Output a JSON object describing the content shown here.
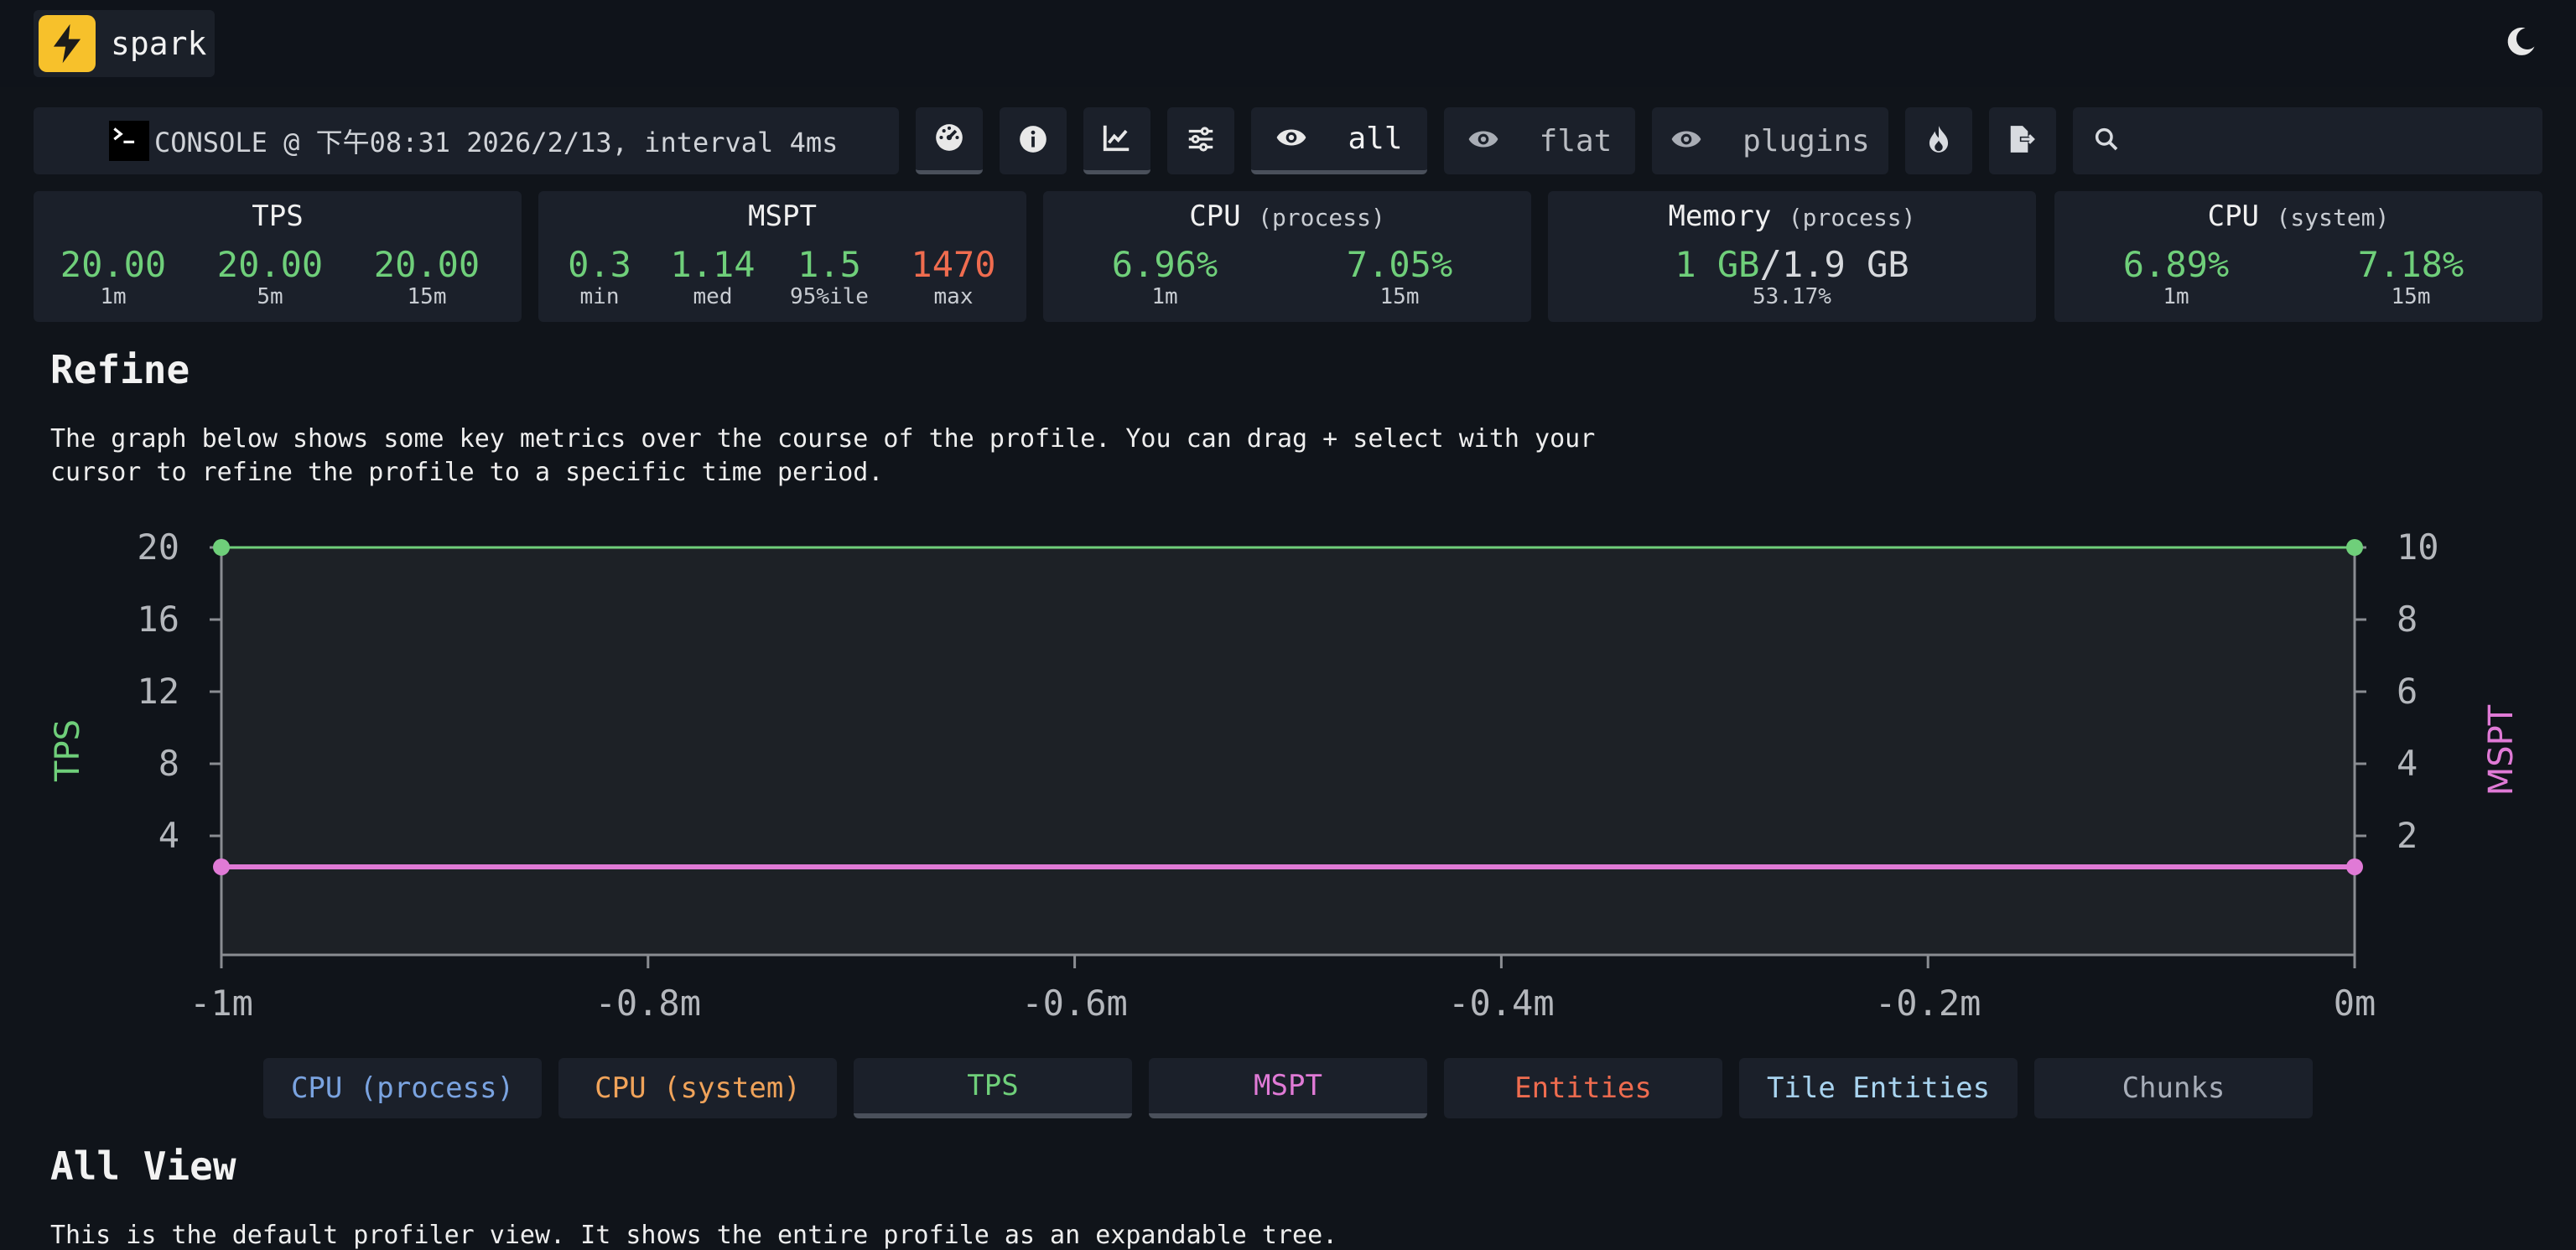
{
  "brand": {
    "name": "spark"
  },
  "toolbar": {
    "console_text": "CONSOLE @ 下午08:31 2026/2/13, interval 4ms",
    "view_all_label": "all",
    "view_flat_label": "flat",
    "view_plugins_label": "plugins",
    "search_placeholder": ""
  },
  "stats": {
    "tps": {
      "title": "TPS",
      "values": [
        "20.00",
        "20.00",
        "20.00"
      ],
      "labels": [
        "1m",
        "5m",
        "15m"
      ]
    },
    "mspt": {
      "title": "MSPT",
      "values": [
        "0.3",
        "1.14",
        "1.5",
        "1470"
      ],
      "labels": [
        "min",
        "med",
        "95%ile",
        "max"
      ]
    },
    "cpu_process": {
      "title": "CPU",
      "sub": "(process)",
      "values": [
        "6.96%",
        "7.05%"
      ],
      "labels": [
        "1m",
        "15m"
      ]
    },
    "memory": {
      "title": "Memory",
      "sub": "(process)",
      "used": "1 GB",
      "sep": "/",
      "total": "1.9 GB",
      "percent": "53.17%"
    },
    "cpu_system": {
      "title": "CPU",
      "sub": "(system)",
      "values": [
        "6.89%",
        "7.18%"
      ],
      "labels": [
        "1m",
        "15m"
      ]
    }
  },
  "refine": {
    "heading": "Refine",
    "desc_line1": "The graph below shows some key metrics over the course of the profile. You can drag + select with your",
    "desc_line2": "cursor to refine the profile to a specific time period."
  },
  "chart_data": {
    "type": "line",
    "x": [
      -1,
      0
    ],
    "x_tick_labels": [
      "-1m",
      "-0.8m",
      "-0.6m",
      "-0.4m",
      "-0.2m",
      "0m"
    ],
    "x_ticks": [
      -1,
      -0.8,
      -0.6,
      -0.4,
      -0.2,
      0
    ],
    "y_left": {
      "label": "TPS",
      "ticks": [
        4,
        8,
        12,
        16,
        20
      ],
      "range": [
        0,
        20
      ]
    },
    "y_right": {
      "label": "MSPT",
      "ticks": [
        2,
        4,
        6,
        8,
        10
      ],
      "range": [
        0,
        10
      ]
    },
    "series": [
      {
        "name": "TPS",
        "axis": "left",
        "color": "#6fcf7a",
        "x": [
          -1,
          0
        ],
        "values": [
          20,
          20
        ]
      },
      {
        "name": "MSPT",
        "axis": "right",
        "color": "#e07ad6",
        "x": [
          -1,
          0
        ],
        "values": [
          1.14,
          1.14
        ]
      }
    ]
  },
  "legend": [
    {
      "label": "CPU (process)",
      "color": "#7aa3e0",
      "active": false
    },
    {
      "label": "CPU (system)",
      "color": "#f0a35a",
      "active": false
    },
    {
      "label": "TPS",
      "color": "#6fcf7a",
      "active": true
    },
    {
      "label": "MSPT",
      "color": "#e07ad6",
      "active": true
    },
    {
      "label": "Entities",
      "color": "#f06c4f",
      "active": false
    },
    {
      "label": "Tile Entities",
      "color": "#a9d4f0",
      "active": false
    },
    {
      "label": "Chunks",
      "color": "#a7adb8",
      "active": false
    }
  ],
  "all_view": {
    "heading": "All View",
    "desc": "This is the default profiler view. It shows the entire profile as an expandable tree."
  }
}
